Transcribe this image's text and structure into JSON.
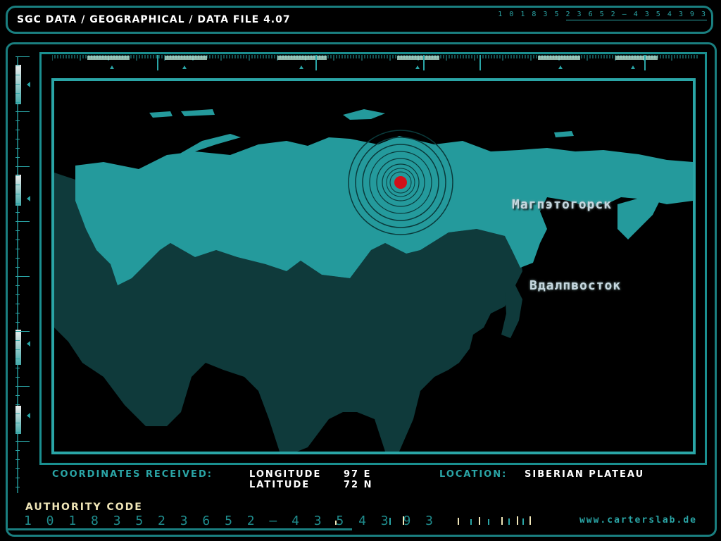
{
  "header": {
    "title": "SGC DATA / GEOGRAPHICAL / DATA FILE 4.07",
    "code": "1 0 1 8 3 5 2 3 6 5 2 — 4 3 5 4 3 9 3"
  },
  "map": {
    "cities": [
      {
        "label": "Магпэтогорск"
      },
      {
        "label": "Вдалпвосток"
      }
    ],
    "colors": {
      "land_north": "#249a9c",
      "land_south": "#0f3a3b",
      "target": "#d0101a"
    }
  },
  "coordinates": {
    "received_label": "COORDINATES RECEIVED:",
    "longitude_label": "LONGITUDE",
    "longitude_value": "97 E",
    "latitude_label": "LATITUDE",
    "latitude_value": "72 N",
    "location_label": "LOCATION:",
    "location_value": "SIBERIAN PLATEAU"
  },
  "footer": {
    "authority_label": "AUTHORITY CODE",
    "authority_code": "1 0 1 8 3 5 2 3 6 5 2 — 4 3 5 4 3 9 3",
    "website": "www.carterslab.de"
  }
}
